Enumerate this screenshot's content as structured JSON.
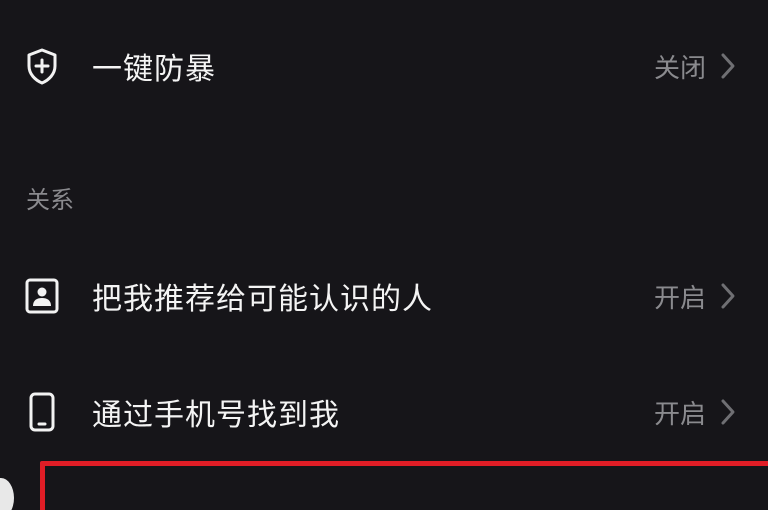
{
  "rows": [
    {
      "id": "anti-harassment",
      "label": "一键防暴",
      "value": "关闭",
      "icon": "shield-plus-icon"
    },
    {
      "id": "recommend-to-acquaintances",
      "label": "把我推荐给可能认识的人",
      "value": "开启",
      "icon": "contact-card-icon"
    },
    {
      "id": "find-by-phone",
      "label": "通过手机号找到我",
      "value": "开启",
      "icon": "phone-icon"
    }
  ],
  "sections": {
    "relationship_header": "关系"
  },
  "colors": {
    "background": "#161519",
    "text_primary": "#f4f4f4",
    "text_secondary": "#8a8a8e",
    "highlight": "#e11d26"
  }
}
